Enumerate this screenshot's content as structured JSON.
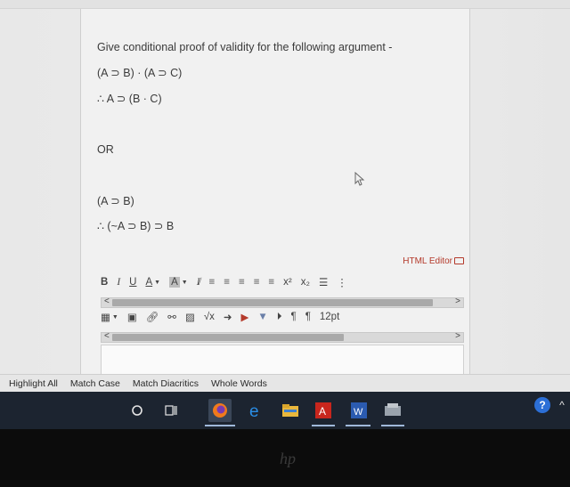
{
  "question": {
    "prompt": "Give conditional proof of validity for the following argument -",
    "arg1_premise": "(A ⊃ B) · (A ⊃ C)",
    "arg1_conclusion": "∴ A ⊃ (B · C)",
    "separator": "OR",
    "arg2_premise": "(A ⊃ B)",
    "arg2_conclusion": "∴ (~A ⊃ B) ⊃ B"
  },
  "editor": {
    "html_editor_label": "HTML Editor",
    "toolbar1": [
      "B",
      "I",
      "U",
      "A",
      "A",
      "I̸",
      "≡",
      "≡",
      "≡",
      "≡",
      "≡",
      "x²",
      "x₂",
      "☰"
    ],
    "font_size": "12pt",
    "sqrt_label": "√x"
  },
  "findbar": {
    "highlight_all": "Highlight All",
    "match_case": "Match Case",
    "match_diacritics": "Match Diacritics",
    "whole_words": "Whole Words"
  },
  "taskbar": {
    "icons": [
      "search-circle",
      "task-view",
      "firefox",
      "edge",
      "file-explorer",
      "acrobat",
      "word",
      "other-app"
    ],
    "help_glyph": "?",
    "chevron": "^"
  },
  "brand": {
    "logo_text": "hp"
  }
}
